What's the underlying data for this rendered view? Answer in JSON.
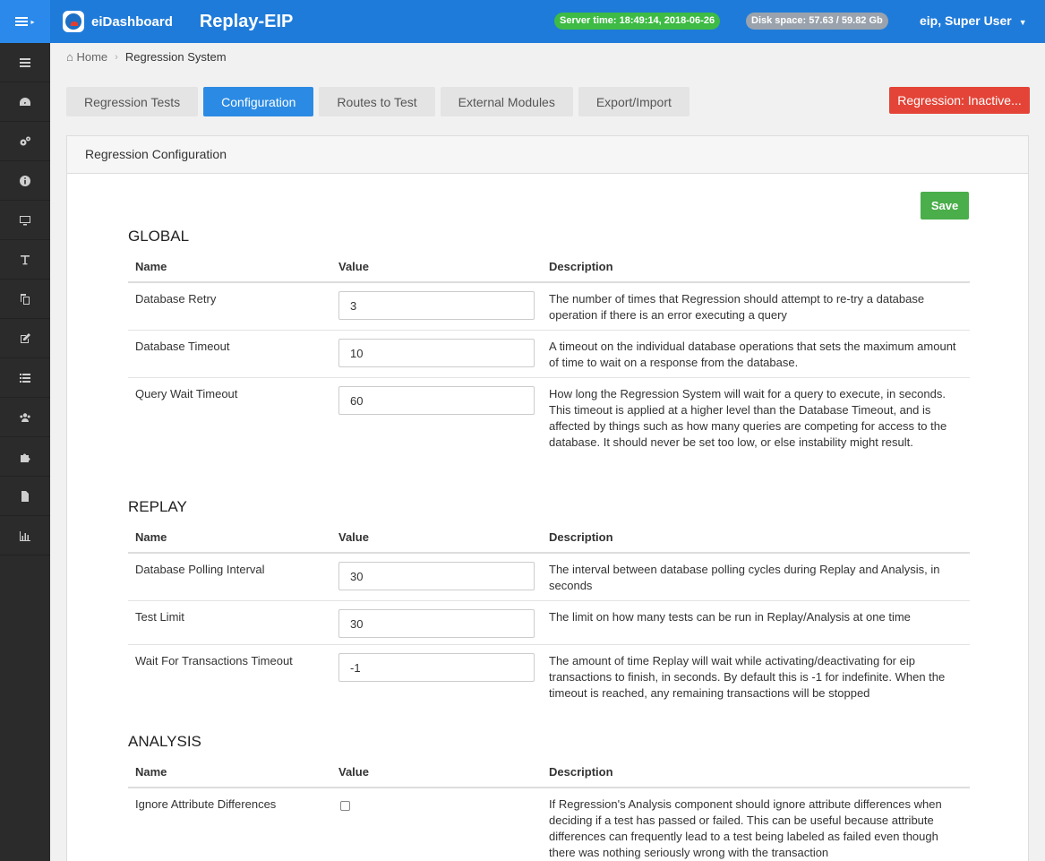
{
  "topbar": {
    "brand": "eiDashboard",
    "app_title": "Replay-EIP",
    "server_time": "Server time: 18:49:14, 2018-06-26",
    "disk_space": "Disk space: 57.63 / 59.82 Gb",
    "user": "eip, Super User"
  },
  "sidebar": {
    "items": [
      "server-icon",
      "dashboard-icon",
      "cogs-icon",
      "info-icon",
      "monitor-icon",
      "text-icon",
      "copy-icon",
      "edit-icon",
      "list-icon",
      "users-icon",
      "puzzle-icon",
      "file-icon",
      "bar-chart-icon"
    ]
  },
  "breadcrumb": {
    "home": "Home",
    "current": "Regression System"
  },
  "tabs": [
    "Regression Tests",
    "Configuration",
    "Routes to Test",
    "External Modules",
    "Export/Import"
  ],
  "active_tab": "Configuration",
  "regression_button": "Regression: Inactive...",
  "panel": {
    "title": "Regression Configuration",
    "save_label": "Save"
  },
  "columns": {
    "name": "Name",
    "value": "Value",
    "description": "Description"
  },
  "sections": {
    "global": {
      "title": "GLOBAL",
      "rows": [
        {
          "name": "Database Retry",
          "value": "3",
          "description": "The number of times that Regression should attempt to re-try a database operation if there is an error executing a query"
        },
        {
          "name": "Database Timeout",
          "value": "10",
          "description": "A timeout on the individual database operations that sets the maximum amount of time to wait on a response from the database."
        },
        {
          "name": "Query Wait Timeout",
          "value": "60",
          "description": "How long the Regression System will wait for a query to execute, in seconds. This timeout is applied at a higher level than the Database Timeout, and is affected by things such as how many queries are competing for access to the database. It should never be set too low, or else instability might result."
        }
      ]
    },
    "replay": {
      "title": "REPLAY",
      "rows": [
        {
          "name": "Database Polling Interval",
          "value": "30",
          "description": "The interval between database polling cycles during Replay and Analysis, in seconds"
        },
        {
          "name": "Test Limit",
          "value": "30",
          "description": "The limit on how many tests can be run in Replay/Analysis at one time"
        },
        {
          "name": "Wait For Transactions Timeout",
          "value": "-1",
          "description": "The amount of time Replay will wait while activating/deactivating for eip transactions to finish, in seconds. By default this is -1 for indefinite. When the timeout is reached, any remaining transactions will be stopped"
        }
      ]
    },
    "analysis": {
      "title": "ANALYSIS",
      "rows": [
        {
          "name": "Ignore Attribute Differences",
          "checked": false,
          "description": "If Regression's Analysis component should ignore attribute differences when deciding if a test has passed or failed. This can be useful because attribute differences can frequently lead to a test being labeled as failed even though there was nothing seriously wrong with the transaction"
        }
      ]
    }
  },
  "colors": {
    "topbar": "#1f7bd9",
    "active_tab": "#2b8be4",
    "danger": "#e34437",
    "success": "#4aae4a",
    "sidebar": "#2b2b2b"
  }
}
